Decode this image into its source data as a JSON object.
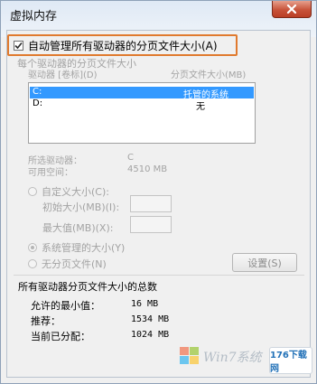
{
  "window": {
    "title": "虚拟内存"
  },
  "auto_manage": {
    "label": "自动管理所有驱动器的分页文件大小(A)",
    "checked": true
  },
  "drive_group": {
    "title": "每个驱动器的分页文件大小",
    "col_drive": "驱动器 [卷标](D)",
    "col_size": "分页文件大小(MB)",
    "rows": [
      {
        "drive": "C:",
        "size": "托管的系统",
        "selected": true
      },
      {
        "drive": "D:",
        "size": "无",
        "selected": false
      }
    ],
    "selected_drive_label": "所选驱动器：",
    "selected_drive_value": "C",
    "available_space_label": "可用空间：",
    "available_space_value": "4510 MB",
    "custom_size_label": "自定义大小(C):",
    "initial_size_label": "初始大小(MB)(I):",
    "max_size_label": "最大值(MB)(X):",
    "system_managed_label": "系统管理的大小(Y)",
    "no_paging_label": "无分页文件(N)",
    "set_button": "设置(S)"
  },
  "summary": {
    "title": "所有驱动器分页文件大小的总数",
    "min_allowed_label": "允许的最小值：",
    "min_allowed_value": "16 MB",
    "recommended_label": "推荐：",
    "recommended_value": "1534 MB",
    "current_label": "当前已分配：",
    "current_value": "1024 MB"
  },
  "watermark": {
    "text": "Win7系统",
    "site": "176下载网"
  },
  "colors": {
    "highlight_box": "#e07a2e",
    "selection": "#3399ff",
    "close_button": "#c8533a"
  }
}
